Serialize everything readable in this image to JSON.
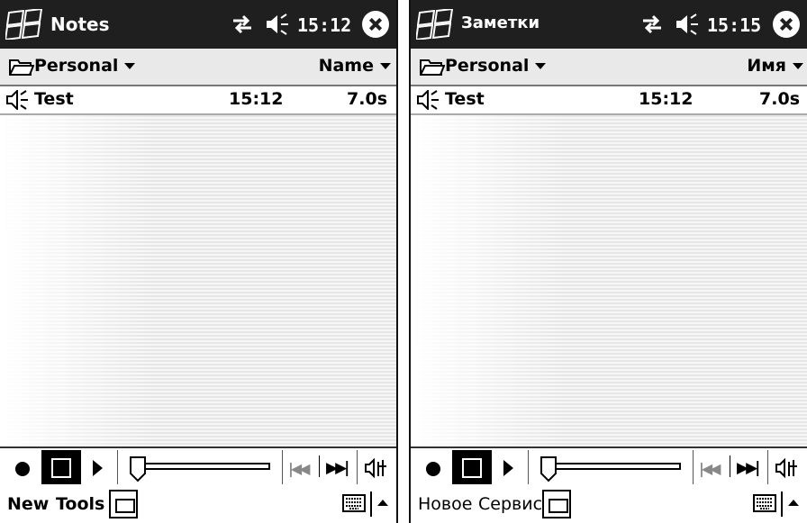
{
  "left": {
    "title": "Notes",
    "time": "15:12",
    "folder": "Personal",
    "sort": "Name",
    "note": {
      "name": "Test",
      "time": "15:12",
      "length": "7.0s"
    },
    "menu": {
      "new": "New",
      "tools": "Tools"
    }
  },
  "right": {
    "title": "Заметки",
    "time": "15:15",
    "folder": "Personal",
    "sort": "Имя",
    "note": {
      "name": "Test",
      "time": "15:12",
      "length": "7.0s"
    },
    "menu": {
      "new": "Новое",
      "tools": "Сервис"
    }
  },
  "icons": [
    "windows-start-icon",
    "connectivity-icon",
    "speaker-icon",
    "close-icon",
    "folder-icon",
    "voice-note-icon",
    "record-icon",
    "stop-icon",
    "play-icon",
    "skip-back-icon",
    "skip-forward-icon",
    "volume-icon",
    "recorder-toggle-icon",
    "keyboard-icon",
    "sip-arrow-icon"
  ]
}
